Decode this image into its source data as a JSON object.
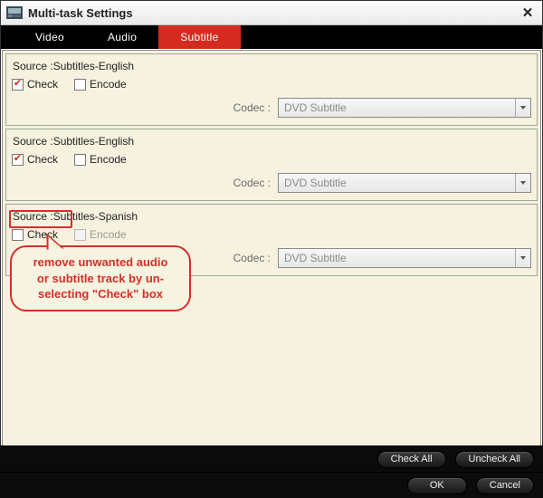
{
  "window": {
    "title": "Multi-task Settings"
  },
  "tabs": {
    "video": "Video",
    "audio": "Audio",
    "subtitle": "Subtitle"
  },
  "labels": {
    "check": "Check",
    "encode": "Encode",
    "codec": "Codec :"
  },
  "tracks": [
    {
      "source": "Source :Subtitles-English",
      "checked": true,
      "encode": false,
      "codec_value": "DVD Subtitle"
    },
    {
      "source": "Source :Subtitles-English",
      "checked": true,
      "encode": false,
      "codec_value": "DVD Subtitle"
    },
    {
      "source": "Source :Subtitles-Spanish",
      "checked": false,
      "encode": false,
      "codec_value": "DVD Subtitle"
    }
  ],
  "annotation": {
    "line1": "remove unwanted audio",
    "line2": "or subtitle track by un-",
    "line3": "selecting \"Check\" box"
  },
  "buttons": {
    "check_all": "Check All",
    "uncheck_all": "Uncheck All",
    "ok": "OK",
    "cancel": "Cancel"
  }
}
